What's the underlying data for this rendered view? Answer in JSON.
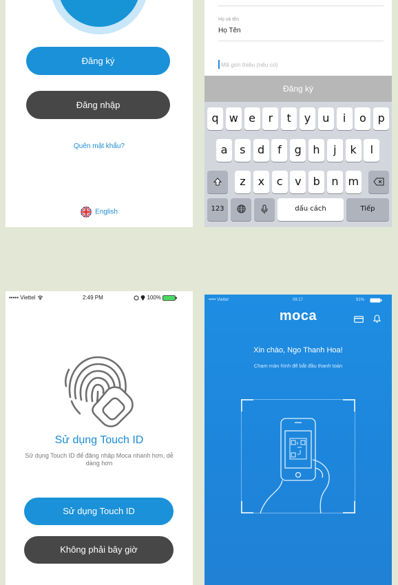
{
  "welcome": {
    "register_label": "Đăng ký",
    "login_label": "Đăng nhập",
    "forgot_label": "Quên mật khẩu?",
    "language_label": "English"
  },
  "register": {
    "fullname_label": "Họ và tên",
    "fullname_value": "Họ Tên",
    "referral_placeholder": "Mã giới thiệu (nếu có)",
    "submit_label": "Đăng ký",
    "keyboard": {
      "row1": [
        "q",
        "w",
        "e",
        "r",
        "t",
        "y",
        "u",
        "i",
        "o",
        "p"
      ],
      "row2": [
        "a",
        "s",
        "d",
        "f",
        "g",
        "h",
        "j",
        "k",
        "l"
      ],
      "row3": [
        "z",
        "x",
        "c",
        "v",
        "b",
        "n",
        "m"
      ],
      "numbers_key": "123",
      "space_key": "dấu cách",
      "next_key": "Tiếp"
    }
  },
  "touch_id": {
    "status": {
      "carrier": "••••• Viettel",
      "time": "2:49 PM",
      "battery": "100%"
    },
    "title": "Sử dụng Touch ID",
    "description": "Sử dụng Touch ID để đăng nhập Moca nhanh hơn, dễ dàng hơn",
    "use_button": "Sử dụng Touch ID",
    "not_now_button": "Không phải bây giờ"
  },
  "home": {
    "status": {
      "carrier": "••••• Viettel",
      "time": "09:17",
      "battery": "91%"
    },
    "logo": "moca",
    "greeting": "Xin chào, Ngo Thanh Hoa!",
    "hint": "Chạm màn hình để bắt đầu thanh toán"
  },
  "colors": {
    "primary_blue": "#1a91d8",
    "dark_button": "#474747",
    "background": "#e2e7d6"
  }
}
